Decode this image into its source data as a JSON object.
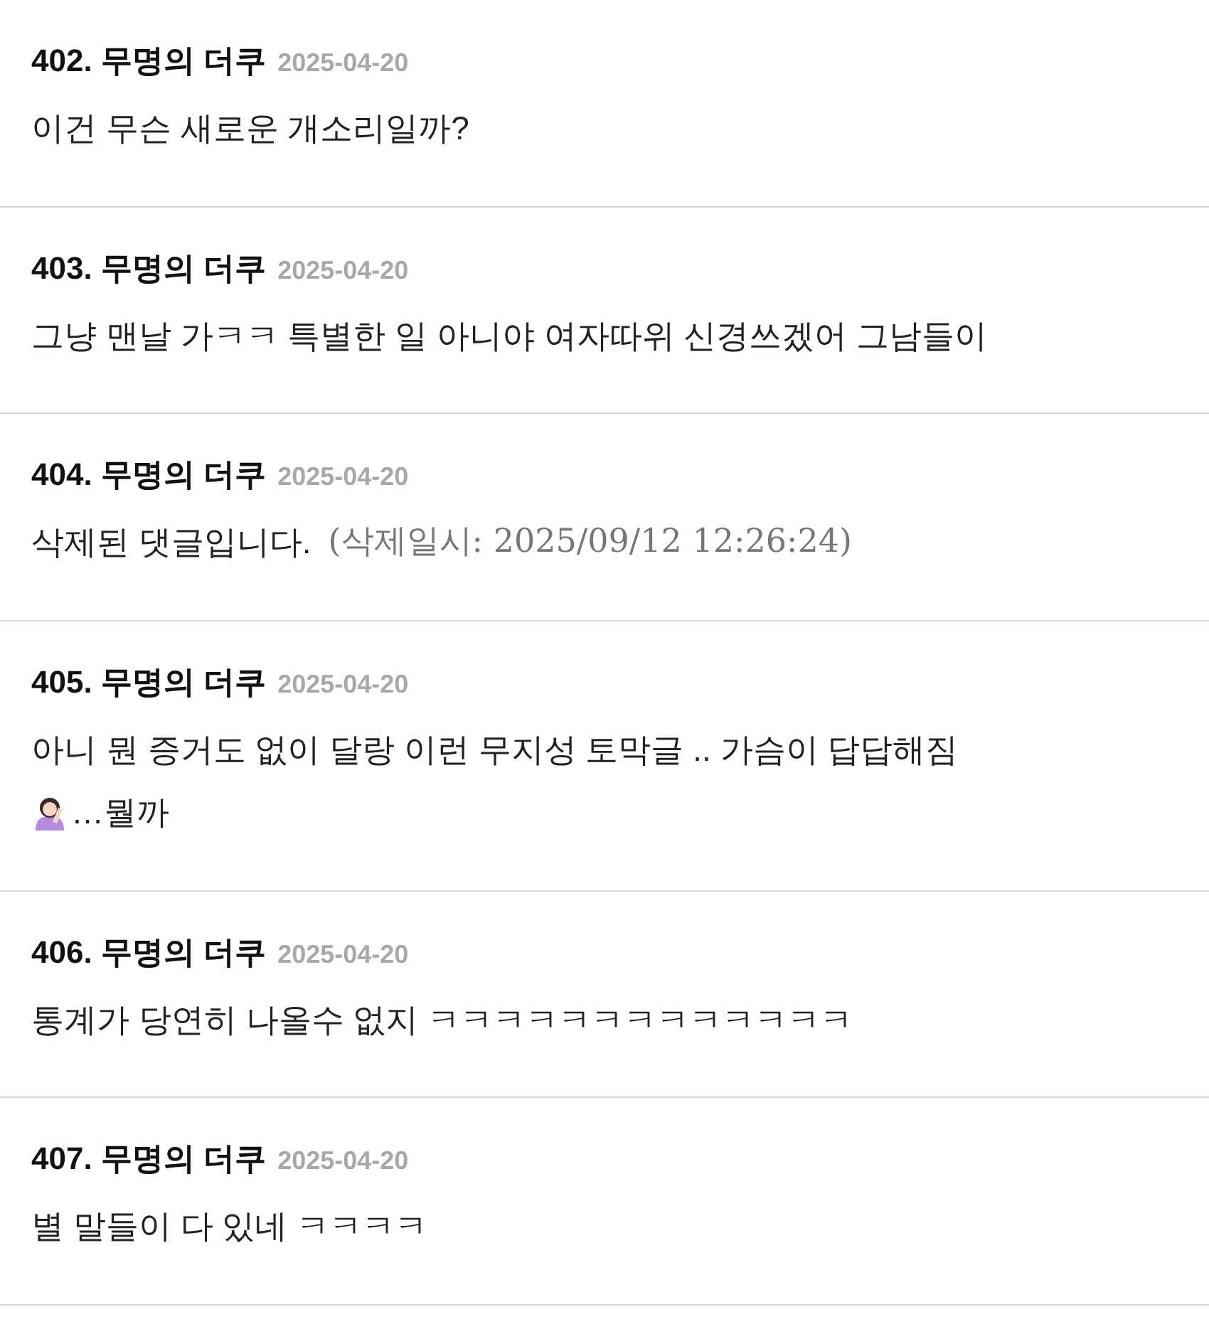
{
  "comments": [
    {
      "number": "402.",
      "author": "무명의 더쿠",
      "date": "2025-04-20",
      "kind": "normal",
      "lines": [
        {
          "text": "이건 무슨 새로운 개소리일까?",
          "lead_icon": false
        }
      ]
    },
    {
      "number": "403.",
      "author": "무명의 더쿠",
      "date": "2025-04-20",
      "kind": "normal",
      "lines": [
        {
          "text": "그냥 맨날 가ㅋㅋ 특별한 일 아니야 여자따위 신경쓰겠어 그남들이",
          "lead_icon": false
        }
      ]
    },
    {
      "number": "404.",
      "author": "무명의 더쿠",
      "date": "2025-04-20",
      "kind": "deleted",
      "lines": [
        {
          "text": "삭제된 댓글입니다.",
          "lead_icon": false
        }
      ],
      "note": "(삭제일시: 2025/09/12 12:26:24)"
    },
    {
      "number": "405.",
      "author": "무명의 더쿠",
      "date": "2025-04-20",
      "kind": "normal",
      "lines": [
        {
          "text": "아니 뭔 증거도 없이 달랑 이런 무지성 토막글 .. 가슴이 답답해짐",
          "lead_icon": false
        },
        {
          "text": "…뭘까",
          "lead_icon": true
        }
      ]
    },
    {
      "number": "406.",
      "author": "무명의 더쿠",
      "date": "2025-04-20",
      "kind": "normal",
      "lines": [
        {
          "text": "통계가 당연히 나올수 없지 ㅋㅋㅋㅋㅋㅋㅋㅋㅋㅋㅋㅋㅋ",
          "lead_icon": false
        }
      ]
    },
    {
      "number": "407.",
      "author": "무명의 더쿠",
      "date": "2025-04-20",
      "kind": "normal",
      "lines": [
        {
          "text": "별 말들이 다 있네 ㅋㅋㅋㅋ",
          "lead_icon": false
        }
      ]
    }
  ]
}
